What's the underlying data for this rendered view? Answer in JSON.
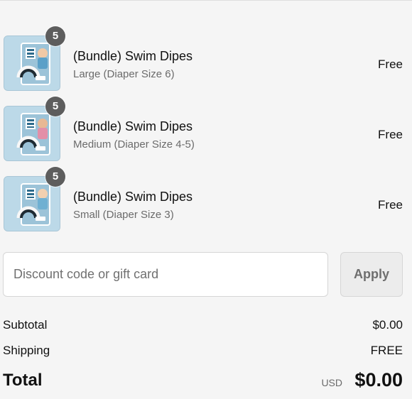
{
  "cart": {
    "items": [
      {
        "quantity": "5",
        "title": "(Bundle) Swim Dipes",
        "variant": "Large (Diaper Size 6)",
        "price": "Free",
        "thumbnail_icon": "swim-diaper-package-icon"
      },
      {
        "quantity": "5",
        "title": "(Bundle) Swim Dipes",
        "variant": "Medium (Diaper Size 4-5)",
        "price": "Free",
        "thumbnail_icon": "swim-diaper-package-icon"
      },
      {
        "quantity": "5",
        "title": "(Bundle) Swim Dipes",
        "variant": "Small (Diaper Size 3)",
        "price": "Free",
        "thumbnail_icon": "swim-diaper-package-icon"
      }
    ]
  },
  "discount": {
    "placeholder": "Discount code or gift card",
    "value": "",
    "apply_label": "Apply"
  },
  "summary": {
    "subtotal_label": "Subtotal",
    "subtotal_value": "$0.00",
    "shipping_label": "Shipping",
    "shipping_value": "FREE",
    "total_label": "Total",
    "currency": "USD",
    "total_value": "$0.00"
  },
  "colors": {
    "background": "#f5f5f5",
    "badge": "#5d5d5d",
    "thumbnail": "#bcd9e8",
    "apply_button_bg": "#ececec",
    "muted_text": "#6b6b6b"
  }
}
